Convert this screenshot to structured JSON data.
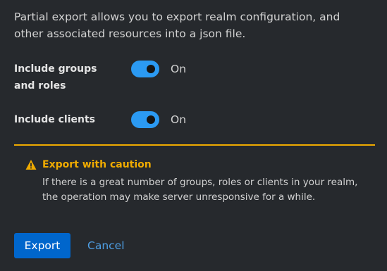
{
  "dialog": {
    "description": "Partial export allows you to export realm configuration, and other associated resources into a json file."
  },
  "fields": [
    {
      "label": "Include groups and roles",
      "state": "On",
      "checked": true
    },
    {
      "label": "Include clients",
      "state": "On",
      "checked": true
    }
  ],
  "alert": {
    "icon": "warning-triangle-icon",
    "title": "Export with caution",
    "body": "If there is a great number of groups, roles or clients in your realm, the operation may make server unresponsive for a while.",
    "color": "#f0ab00"
  },
  "actions": {
    "export_label": "Export",
    "cancel_label": "Cancel"
  },
  "colors": {
    "background": "#26292d",
    "switch_on": "#2b9af3",
    "primary": "#0066cc",
    "link": "#4e9fe5"
  }
}
